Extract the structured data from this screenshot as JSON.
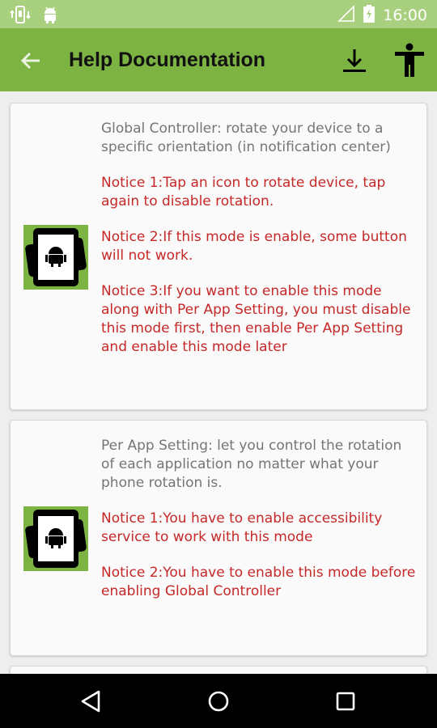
{
  "status_bar": {
    "time": "16:00",
    "icons": [
      "screen-rotation-icon",
      "android-icon",
      "signal-icon",
      "battery-charging-icon"
    ]
  },
  "app_bar": {
    "title": "Help Documentation",
    "icons": [
      "back-arrow-icon",
      "download-icon",
      "accessibility-icon"
    ]
  },
  "cards": [
    {
      "description": "Global Controller: rotate your device to a specific orientation (in notification center)",
      "notices": [
        "Notice 1:Tap an icon to rotate device, tap again to disable rotation.",
        "Notice 2:If this mode is enable, some button will not work.",
        "Notice 3:If you want to enable this mode along with Per App Setting, you must disable this mode first, then enable Per App Setting and enable this mode later"
      ]
    },
    {
      "description": "Per App Setting: let you control the rotation of each application no matter what your phone rotation is.",
      "notices": [
        "Notice 1:You have to enable accessibility service to work with this mode",
        "Notice 2:You have to enable this mode before enabling Global Controller"
      ]
    }
  ],
  "nav_bar": {
    "icons": [
      "back-triangle-icon",
      "home-circle-icon",
      "recents-square-icon"
    ]
  },
  "colors": {
    "status_bar": "#a9d07e",
    "app_bar": "#7cb342",
    "description_text": "#757575",
    "notice_text": "#c62828"
  }
}
